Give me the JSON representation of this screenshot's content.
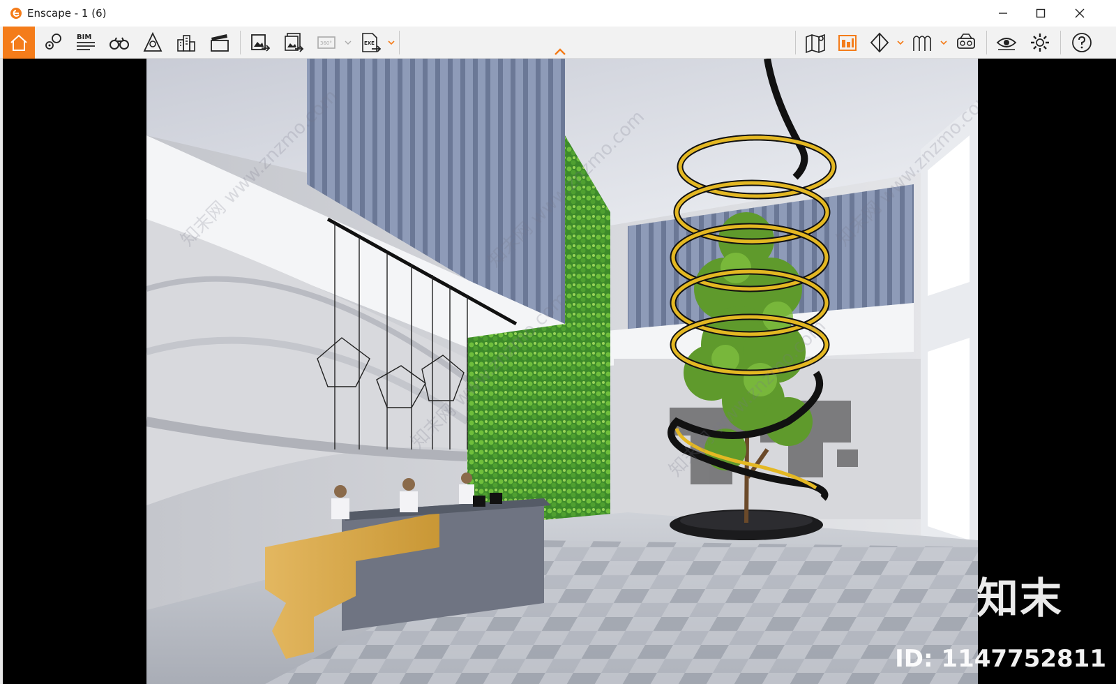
{
  "window": {
    "title": "Enscape - 1 (6)",
    "controls": [
      "minimize",
      "maximize",
      "close"
    ]
  },
  "toolbar": {
    "left_items": [
      {
        "icon": "home-icon",
        "active": true
      },
      {
        "icon": "view-management-icon"
      },
      {
        "icon": "bim-icon",
        "label": "BIM"
      },
      {
        "icon": "binoculars-icon"
      },
      {
        "icon": "perspective-icon"
      },
      {
        "icon": "city-icon"
      },
      {
        "icon": "video-editor-icon"
      },
      {
        "icon": "render-image-icon"
      },
      {
        "icon": "batch-render-icon"
      },
      {
        "icon": "panorama-icon",
        "label": "360°",
        "disabled": true
      },
      {
        "icon": "export-exe-icon",
        "label": "EXE"
      }
    ],
    "right_items": [
      {
        "icon": "map-icon"
      },
      {
        "icon": "asset-library-icon"
      },
      {
        "icon": "section-icon"
      },
      {
        "icon": "material-icon"
      },
      {
        "icon": "vr-headset-icon"
      },
      {
        "icon": "visual-settings-icon"
      },
      {
        "icon": "settings-icon"
      },
      {
        "icon": "help-icon"
      }
    ],
    "accent_color": "#f47c1a"
  },
  "watermark": {
    "brand": "知末",
    "id": "ID: 1147752811",
    "diagonal_text": "知末网 www.znzmo.com"
  }
}
